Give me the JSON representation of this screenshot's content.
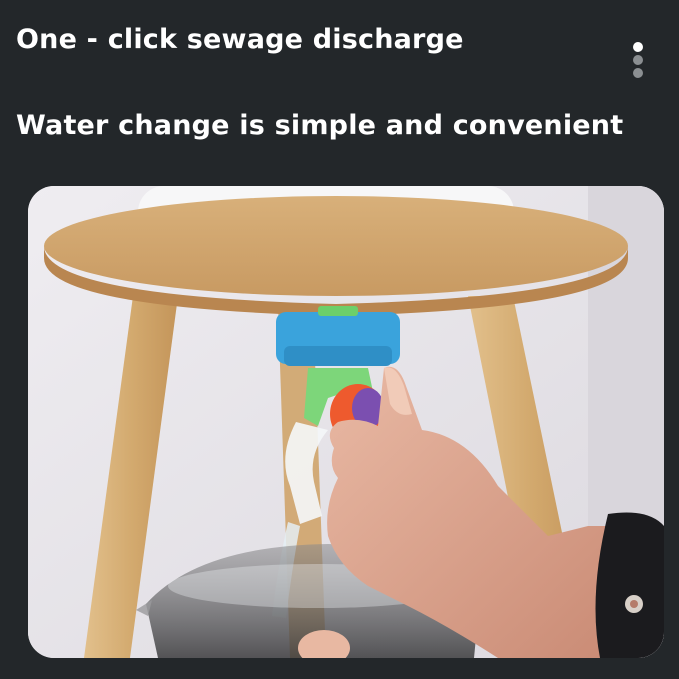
{
  "headlines": {
    "line1": "One - click sewage discharge",
    "line2": "Water change is simple and convenient"
  },
  "pager": {
    "total": 3,
    "active_index": 0
  },
  "colors": {
    "background": "#23272a",
    "headline_text": "#ffffff",
    "dot_active": "#ffffff",
    "dot_inactive": "#8b8f92"
  },
  "photo": {
    "icon": "product-photo"
  }
}
